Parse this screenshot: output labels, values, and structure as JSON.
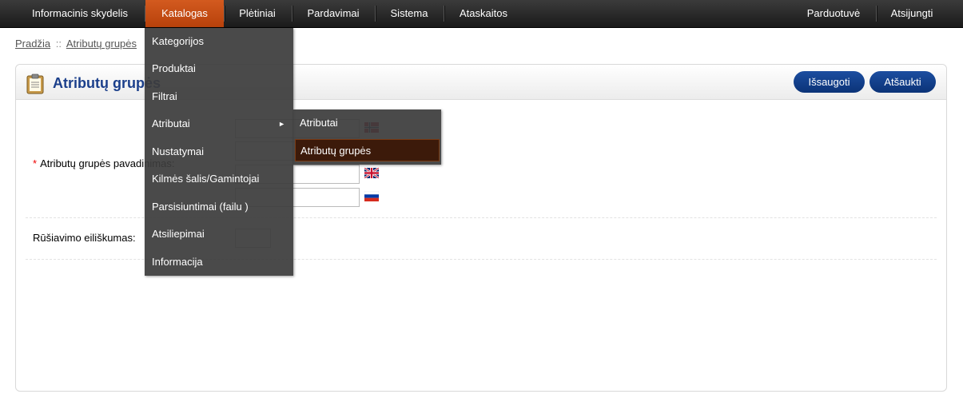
{
  "topnav": {
    "left": [
      "Informacinis skydelis",
      "Katalogas",
      "Plėtiniai",
      "Pardavimai",
      "Sistema",
      "Ataskaitos"
    ],
    "right": [
      "Parduotuvė",
      "Atsijungti"
    ],
    "active": "Katalogas"
  },
  "breadcrumb": {
    "home": "Pradžia",
    "separator": "::",
    "current": "Atributų grupės"
  },
  "panel": {
    "title": "Atributų grupės",
    "icon": "clipboard-icon",
    "buttons": {
      "save": "Išsaugoti",
      "cancel": "Atšaukti"
    }
  },
  "form": {
    "name_label": "Atributų grupės pavadinimas:",
    "required_mark": "*",
    "languages": [
      "norway-flag-icon",
      "uk-flag-icon",
      "uk-flag-icon",
      "russia-flag-icon"
    ],
    "sort_label": "Rūšiavimo eiliškumas:"
  },
  "dropdown": {
    "items": [
      "Kategorijos",
      "Produktai",
      "Filtrai",
      "Atributai",
      "Nustatymai",
      "Kilmės šalis/Gamintojai",
      "Parsisiuntimai (failu )",
      "Atsiliepimai",
      "Informacija"
    ],
    "arrow": "►",
    "submenu": [
      "Atributai",
      "Atributų grupės"
    ],
    "submenu_selected": "Atributų grupės"
  },
  "colors": {
    "active_tab": "#c34c14",
    "title": "#1b3f8b",
    "button": "#0b3377",
    "selected_submenu": "#3c1a0a"
  }
}
